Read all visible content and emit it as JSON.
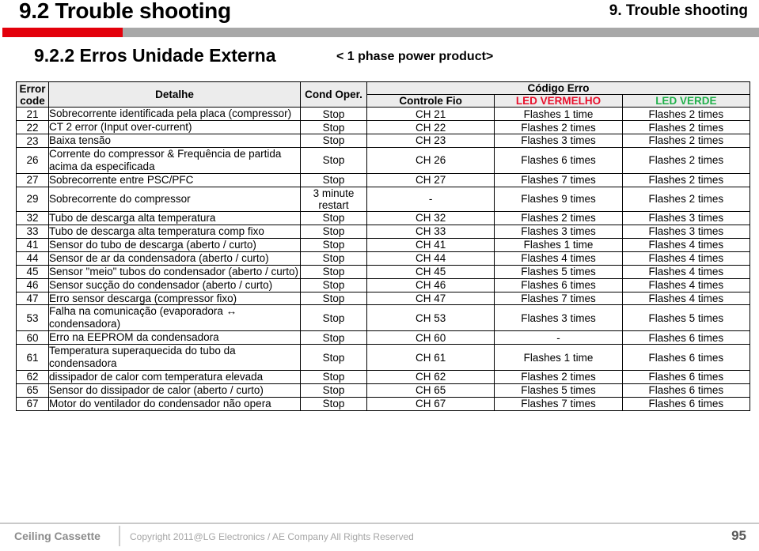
{
  "header": {
    "title": "9.2 Trouble shooting",
    "chapter": "9. Trouble shooting",
    "bar_red": "#e3000b",
    "bar_gray": "#a8a8a8"
  },
  "section": {
    "title": "9.2.2 Erros Unidade Externa",
    "note": "< 1 phase power product>"
  },
  "table": {
    "headers": {
      "error_code": "Error\ncode",
      "error_code_line1": "Error",
      "error_code_line2": "code",
      "detalhe": "Detalhe",
      "cond_oper": "Cond Oper.",
      "codigo_erro": "Código Erro",
      "controle_fio": "Controle Fio",
      "led_vermelho": "LED VERMELHO",
      "led_verde": "LED VERDE",
      "led_vermelho_color": "#e8112d",
      "led_verde_color": "#22b14c"
    },
    "rows": [
      {
        "code": "21",
        "detail": "Sobrecorrente identificada pela placa (compressor)",
        "cond": "Stop",
        "fio": "CH 21",
        "red": "Flashes 1 time",
        "green": "Flashes 2 times"
      },
      {
        "code": "22",
        "detail": "CT 2 error (Input over-current)",
        "cond": "Stop",
        "fio": "CH 22",
        "red": "Flashes 2 times",
        "green": "Flashes 2 times"
      },
      {
        "code": "23",
        "detail": "Baixa tensão",
        "cond": "Stop",
        "fio": "CH 23",
        "red": "Flashes 3 times",
        "green": "Flashes 2 times"
      },
      {
        "code": "26",
        "detail": "Corrente do compressor & Frequência de partida acima da especificada",
        "cond": "Stop",
        "fio": "CH 26",
        "red": "Flashes 6 times",
        "green": "Flashes 2 times"
      },
      {
        "code": "27",
        "detail": "Sobrecorrente entre PSC/PFC",
        "cond": "Stop",
        "fio": "CH 27",
        "red": "Flashes 7 times",
        "green": "Flashes 2 times"
      },
      {
        "code": "29",
        "detail": "Sobrecorrente do compressor",
        "cond": "3 minute restart",
        "fio": "-",
        "red": "Flashes 9 times",
        "green": "Flashes 2 times"
      },
      {
        "code": "32",
        "detail": "Tubo de descarga alta temperatura",
        "cond": "Stop",
        "fio": "CH 32",
        "red": "Flashes 2 times",
        "green": "Flashes 3 times"
      },
      {
        "code": "33",
        "detail": "Tubo de descarga alta temperatura comp fixo",
        "cond": "Stop",
        "fio": "CH 33",
        "red": "Flashes 3 times",
        "green": "Flashes 3 times"
      },
      {
        "code": "41",
        "detail": "Sensor do tubo de descarga (aberto / curto)",
        "cond": "Stop",
        "fio": "CH 41",
        "red": "Flashes 1 time",
        "green": "Flashes 4 times"
      },
      {
        "code": "44",
        "detail": "Sensor de ar da condensadora (aberto / curto)",
        "cond": "Stop",
        "fio": "CH 44",
        "red": "Flashes 4 times",
        "green": "Flashes 4 times"
      },
      {
        "code": "45",
        "detail": "Sensor \"meio\" tubos do condensador (aberto / curto)",
        "cond": "Stop",
        "fio": "CH 45",
        "red": "Flashes 5 times",
        "green": "Flashes 4 times"
      },
      {
        "code": "46",
        "detail": "Sensor sucção do condensador (aberto / curto)",
        "cond": "Stop",
        "fio": "CH 46",
        "red": "Flashes 6 times",
        "green": "Flashes 4 times"
      },
      {
        "code": "47",
        "detail": "Erro sensor descarga (compressor  fixo)",
        "cond": "Stop",
        "fio": "CH 47",
        "red": "Flashes 7 times",
        "green": "Flashes 4 times"
      },
      {
        "code": "53",
        "detail": "Falha na comunicação (evaporadora ↔ condensadora)",
        "cond": "Stop",
        "fio": "CH 53",
        "red": "Flashes 3 times",
        "green": "Flashes 5 times"
      },
      {
        "code": "60",
        "detail": "Erro na EEPROM da condensadora",
        "cond": "Stop",
        "fio": "CH 60",
        "red": "-",
        "green": "Flashes 6 times"
      },
      {
        "code": "61",
        "detail": "Temperatura superaquecida do tubo da condensadora",
        "cond": "Stop",
        "fio": "CH 61",
        "red": "Flashes 1 time",
        "green": "Flashes 6 times"
      },
      {
        "code": "62",
        "detail": "dissipador de calor com temperatura elevada",
        "cond": "Stop",
        "fio": "CH 62",
        "red": "Flashes 2 times",
        "green": "Flashes 6 times"
      },
      {
        "code": "65",
        "detail": "Sensor do dissipador de calor (aberto / curto)",
        "cond": "Stop",
        "fio": "CH 65",
        "red": "Flashes 5 times",
        "green": "Flashes 6 times"
      },
      {
        "code": "67",
        "detail": "Motor do ventilador do condensador não opera",
        "cond": "Stop",
        "fio": "CH 67",
        "red": "Flashes 7 times",
        "green": "Flashes 6 times"
      }
    ]
  },
  "footer": {
    "brand": "Ceiling Cassette",
    "copyright": "Copyright 2011@LG Electronics / AE Company All Rights Reserved",
    "page": "95"
  }
}
